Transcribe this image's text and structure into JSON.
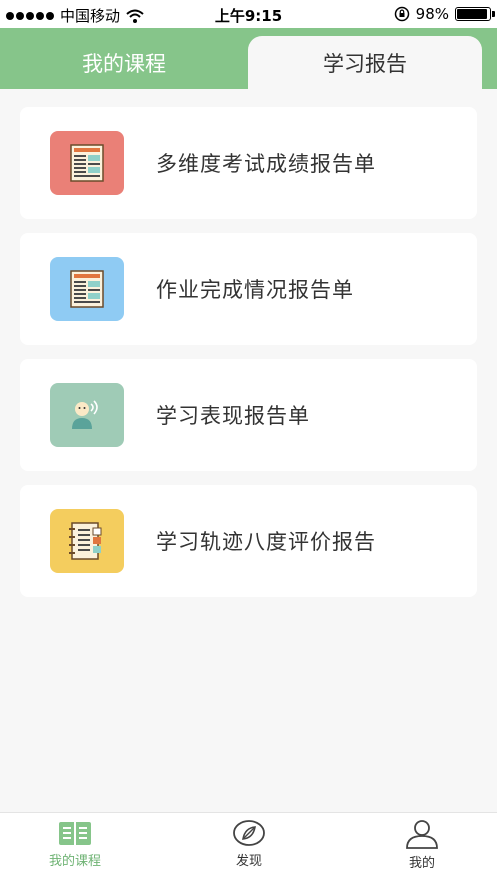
{
  "status_bar": {
    "carrier": "中国移动",
    "time": "上午9:15",
    "battery": "98%",
    "battery_level": 0.98,
    "signal_icon": "signal-dots-icon",
    "wifi_icon": "wifi-icon",
    "lock_icon": "rotation-lock-icon"
  },
  "tabs": [
    {
      "label": "我的课程",
      "active": false
    },
    {
      "label": "学习报告",
      "active": true
    }
  ],
  "reports": [
    {
      "label": "多维度考试成绩报告单",
      "icon": "report-sheet-icon",
      "color": "#ea8077"
    },
    {
      "label": "作业完成情况报告单",
      "icon": "report-sheet-icon",
      "color": "#8fcbf3"
    },
    {
      "label": "学习表现报告单",
      "icon": "student-speaking-icon",
      "color": "#9fcbb6"
    },
    {
      "label": "学习轨迹八度评价报告",
      "icon": "notebook-icon",
      "color": "#f4cd5e"
    }
  ],
  "tab_bar": [
    {
      "label": "我的课程",
      "icon": "open-book-icon",
      "active": true
    },
    {
      "label": "发现",
      "icon": "compass-icon",
      "active": false
    },
    {
      "label": "我的",
      "icon": "user-icon",
      "active": false
    }
  ],
  "colors": {
    "brand_green": "#86c58a",
    "background": "#f7f7f7",
    "tab_inactive": "#333333"
  }
}
